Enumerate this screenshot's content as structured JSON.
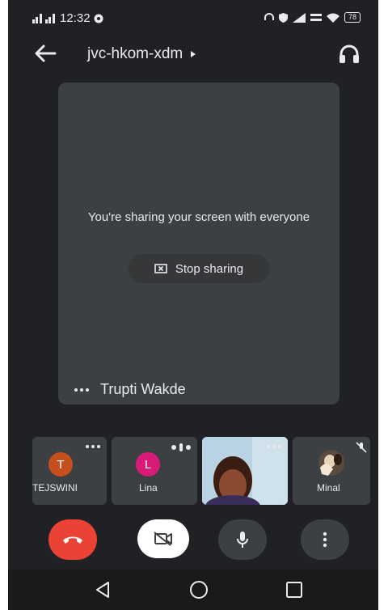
{
  "status_bar": {
    "time": "12:32",
    "battery": "78"
  },
  "meeting": {
    "code": "jvc-hkom-xdm"
  },
  "share": {
    "message": "You're sharing your screen with everyone",
    "stop_label": "Stop sharing",
    "presenter_name": "Trupti Wakde"
  },
  "participants": [
    {
      "initial": "T",
      "name": "TEJSWINI",
      "avatar_color": "#c5501e"
    },
    {
      "initial": "L",
      "name": "Lina",
      "avatar_color": "#d81b78"
    },
    {
      "name": ""
    },
    {
      "name": "Minal"
    }
  ],
  "colors": {
    "background": "#202124",
    "tile": "#3c4043",
    "end_call": "#ea4335",
    "camera_off_button": "#ffffff"
  },
  "icons": {
    "back": "arrow-left",
    "audio_output": "headphones",
    "stop_share": "screen-x",
    "end_call": "phone-hangup",
    "camera": "camera-off",
    "mic": "microphone",
    "more": "dots-vertical"
  }
}
